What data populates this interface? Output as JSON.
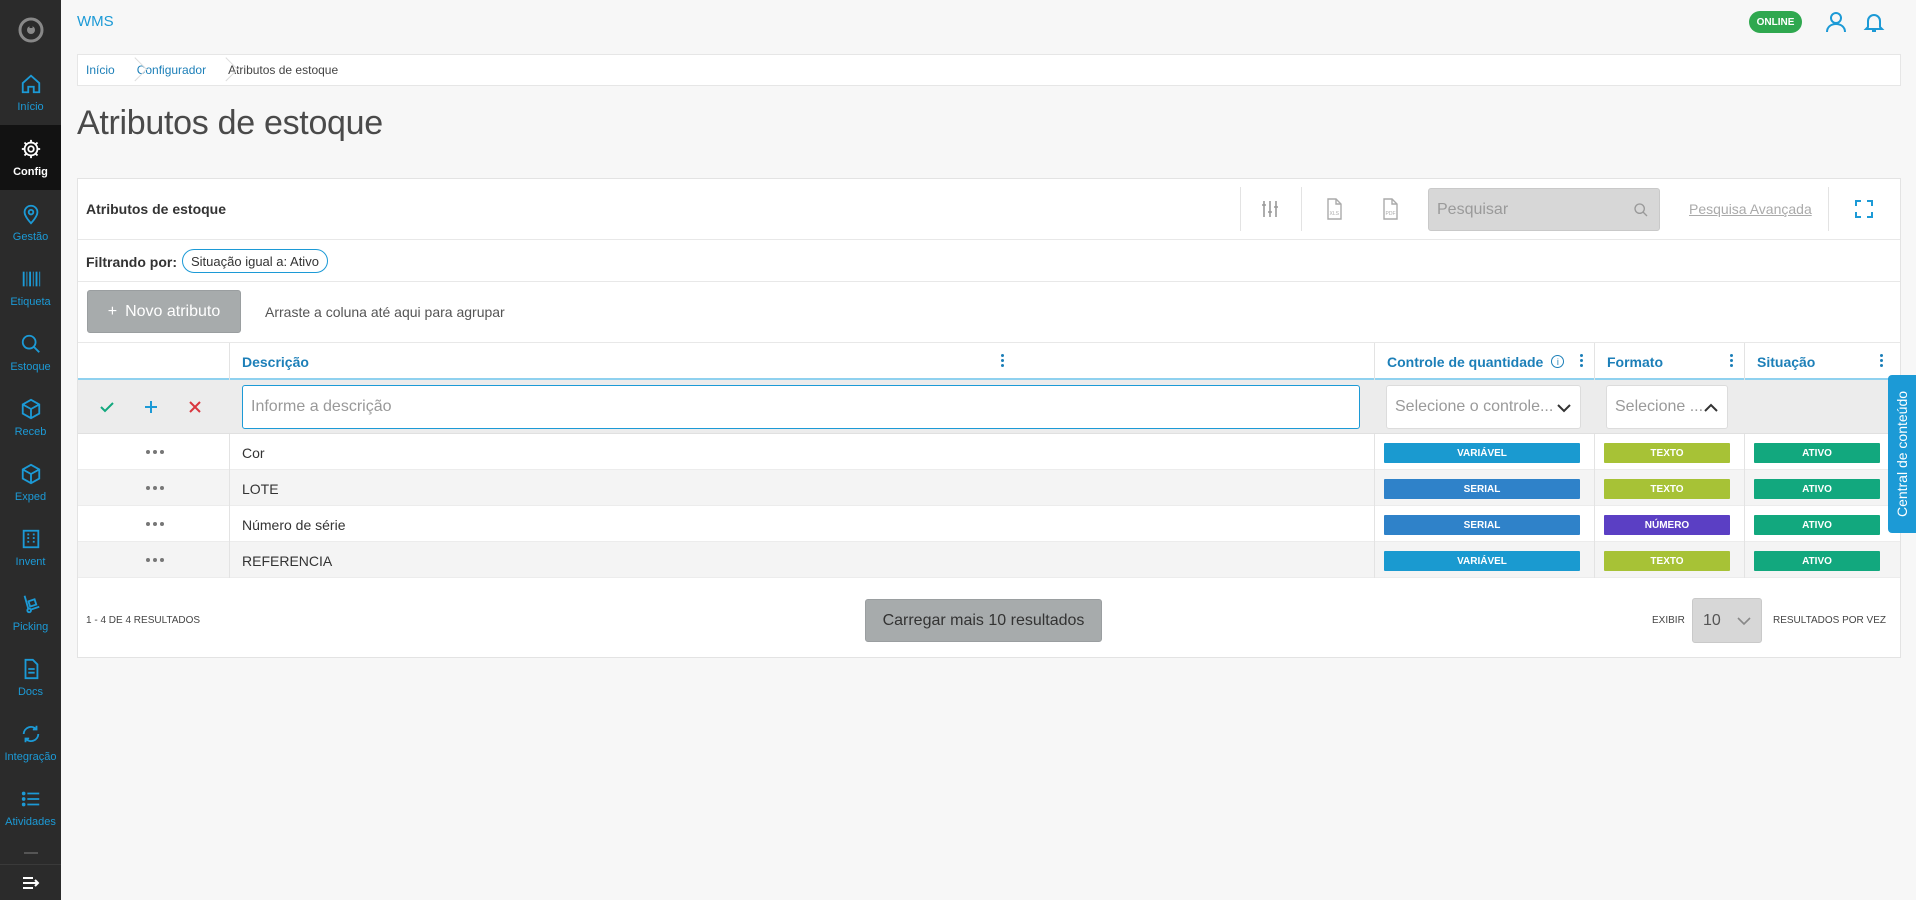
{
  "sidebar": {
    "items": [
      {
        "label": "Início",
        "icon": "home-icon"
      },
      {
        "label": "Config",
        "icon": "gear-icon"
      },
      {
        "label": "Gestão",
        "icon": "map-pin-icon"
      },
      {
        "label": "Etiqueta",
        "icon": "barcode-icon"
      },
      {
        "label": "Estoque",
        "icon": "search-icon"
      },
      {
        "label": "Receb",
        "icon": "box-icon"
      },
      {
        "label": "Exped",
        "icon": "box-icon"
      },
      {
        "label": "Invent",
        "icon": "building-icon"
      },
      {
        "label": "Picking",
        "icon": "hand-truck-icon"
      },
      {
        "label": "Docs",
        "icon": "document-icon"
      },
      {
        "label": "Integração",
        "icon": "sync-icon"
      },
      {
        "label": "Atividades",
        "icon": "list-icon"
      }
    ],
    "active_index": 1
  },
  "header": {
    "app_title": "WMS",
    "status": "ONLINE"
  },
  "breadcrumb": [
    "Início",
    "Configurador",
    "Atributos de estoque"
  ],
  "page_title": "Atributos de estoque",
  "card": {
    "title": "Atributos de estoque",
    "search_placeholder": "Pesquisar",
    "advanced_search": "Pesquisa Avançada",
    "filter_label": "Filtrando por:",
    "filter_chip": "Situação igual a: Ativo",
    "new_button": "Novo atributo",
    "group_hint": "Arraste a coluna até aqui para agrupar"
  },
  "table": {
    "columns": [
      "Descrição",
      "Controle de quantidade",
      "Formato",
      "Situação"
    ],
    "edit_row": {
      "description_placeholder": "Informe a descrição",
      "control_placeholder": "Selecione o controle...",
      "format_placeholder": "Selecione ..."
    },
    "rows": [
      {
        "descricao": "Cor",
        "controle": "VARIÁVEL",
        "formato": "TEXTO",
        "situacao": "ATIVO"
      },
      {
        "descricao": "LOTE",
        "controle": "SERIAL",
        "formato": "TEXTO",
        "situacao": "ATIVO"
      },
      {
        "descricao": "Número de série",
        "controle": "SERIAL",
        "formato": "NÚMERO",
        "situacao": "ATIVO"
      },
      {
        "descricao": "REFERENCIA",
        "controle": "VARIÁVEL",
        "formato": "TEXTO",
        "situacao": "ATIVO"
      }
    ]
  },
  "footer": {
    "results": "1 - 4 DE 4 RESULTADOS",
    "load_more": "Carregar mais 10 resultados",
    "show_label": "EXIBIR",
    "page_size": "10",
    "per_time": "RESULTADOS POR VEZ"
  },
  "side_tab": "Central de conteúdo",
  "colors": {
    "accent": "#1c9ad6",
    "variavel": "#1a9ad0",
    "serial": "#2f82c9",
    "texto": "#a7c236",
    "numero": "#5b3fc4",
    "ativo": "#12a87e",
    "online": "#2fa84f"
  }
}
